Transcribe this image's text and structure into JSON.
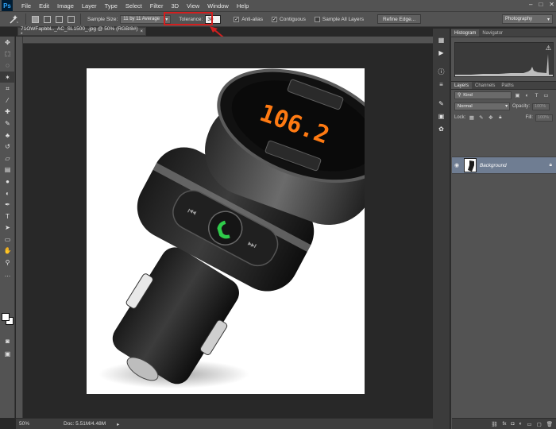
{
  "app": {
    "logo": "Ps"
  },
  "menu": [
    "File",
    "Edit",
    "Image",
    "Layer",
    "Type",
    "Select",
    "Filter",
    "3D",
    "View",
    "Window",
    "Help"
  ],
  "window_controls": [
    "–",
    "□",
    "✕"
  ],
  "options": {
    "sample_size_label": "Sample Size:",
    "sample_size_value": "11 by 11 Average",
    "tolerance_label": "Tolerance:",
    "tolerance_value": "30",
    "anti_alias_label": "Anti-alias",
    "contiguous_label": "Contiguous",
    "sample_all_layers_label": "Sample All Layers",
    "refine_edge_label": "Refine Edge...",
    "anti_alias_checked": true,
    "contiguous_checked": true,
    "sample_all_layers_checked": false
  },
  "workspace": {
    "value": "Photography"
  },
  "document": {
    "tab_title": "71OWFapbbL._AC_SL1500_.jpg @ 50% (RGB/8#) *",
    "close": "×",
    "display_reading": "106.2"
  },
  "status": {
    "zoom": "50%",
    "doc_info": "Doc: 5.51M/4.48M",
    "arrow": "▸"
  },
  "panels": {
    "top_tabs": [
      "Histogram",
      "Navigator"
    ],
    "layer_tabs": [
      "Layers",
      "Channels",
      "Paths"
    ],
    "kind_label": "Kind",
    "blend_mode": "Normal",
    "opacity_label": "Opacity:",
    "opacity_value": "100%",
    "lock_label": "Lock:",
    "fill_label": "Fill:",
    "fill_value": "100%",
    "layer_name": "Background"
  },
  "colors": {
    "accent_annotation": "#d21f1f",
    "selected_layer": "#6f7d92",
    "canvas_bg": "#282828"
  }
}
